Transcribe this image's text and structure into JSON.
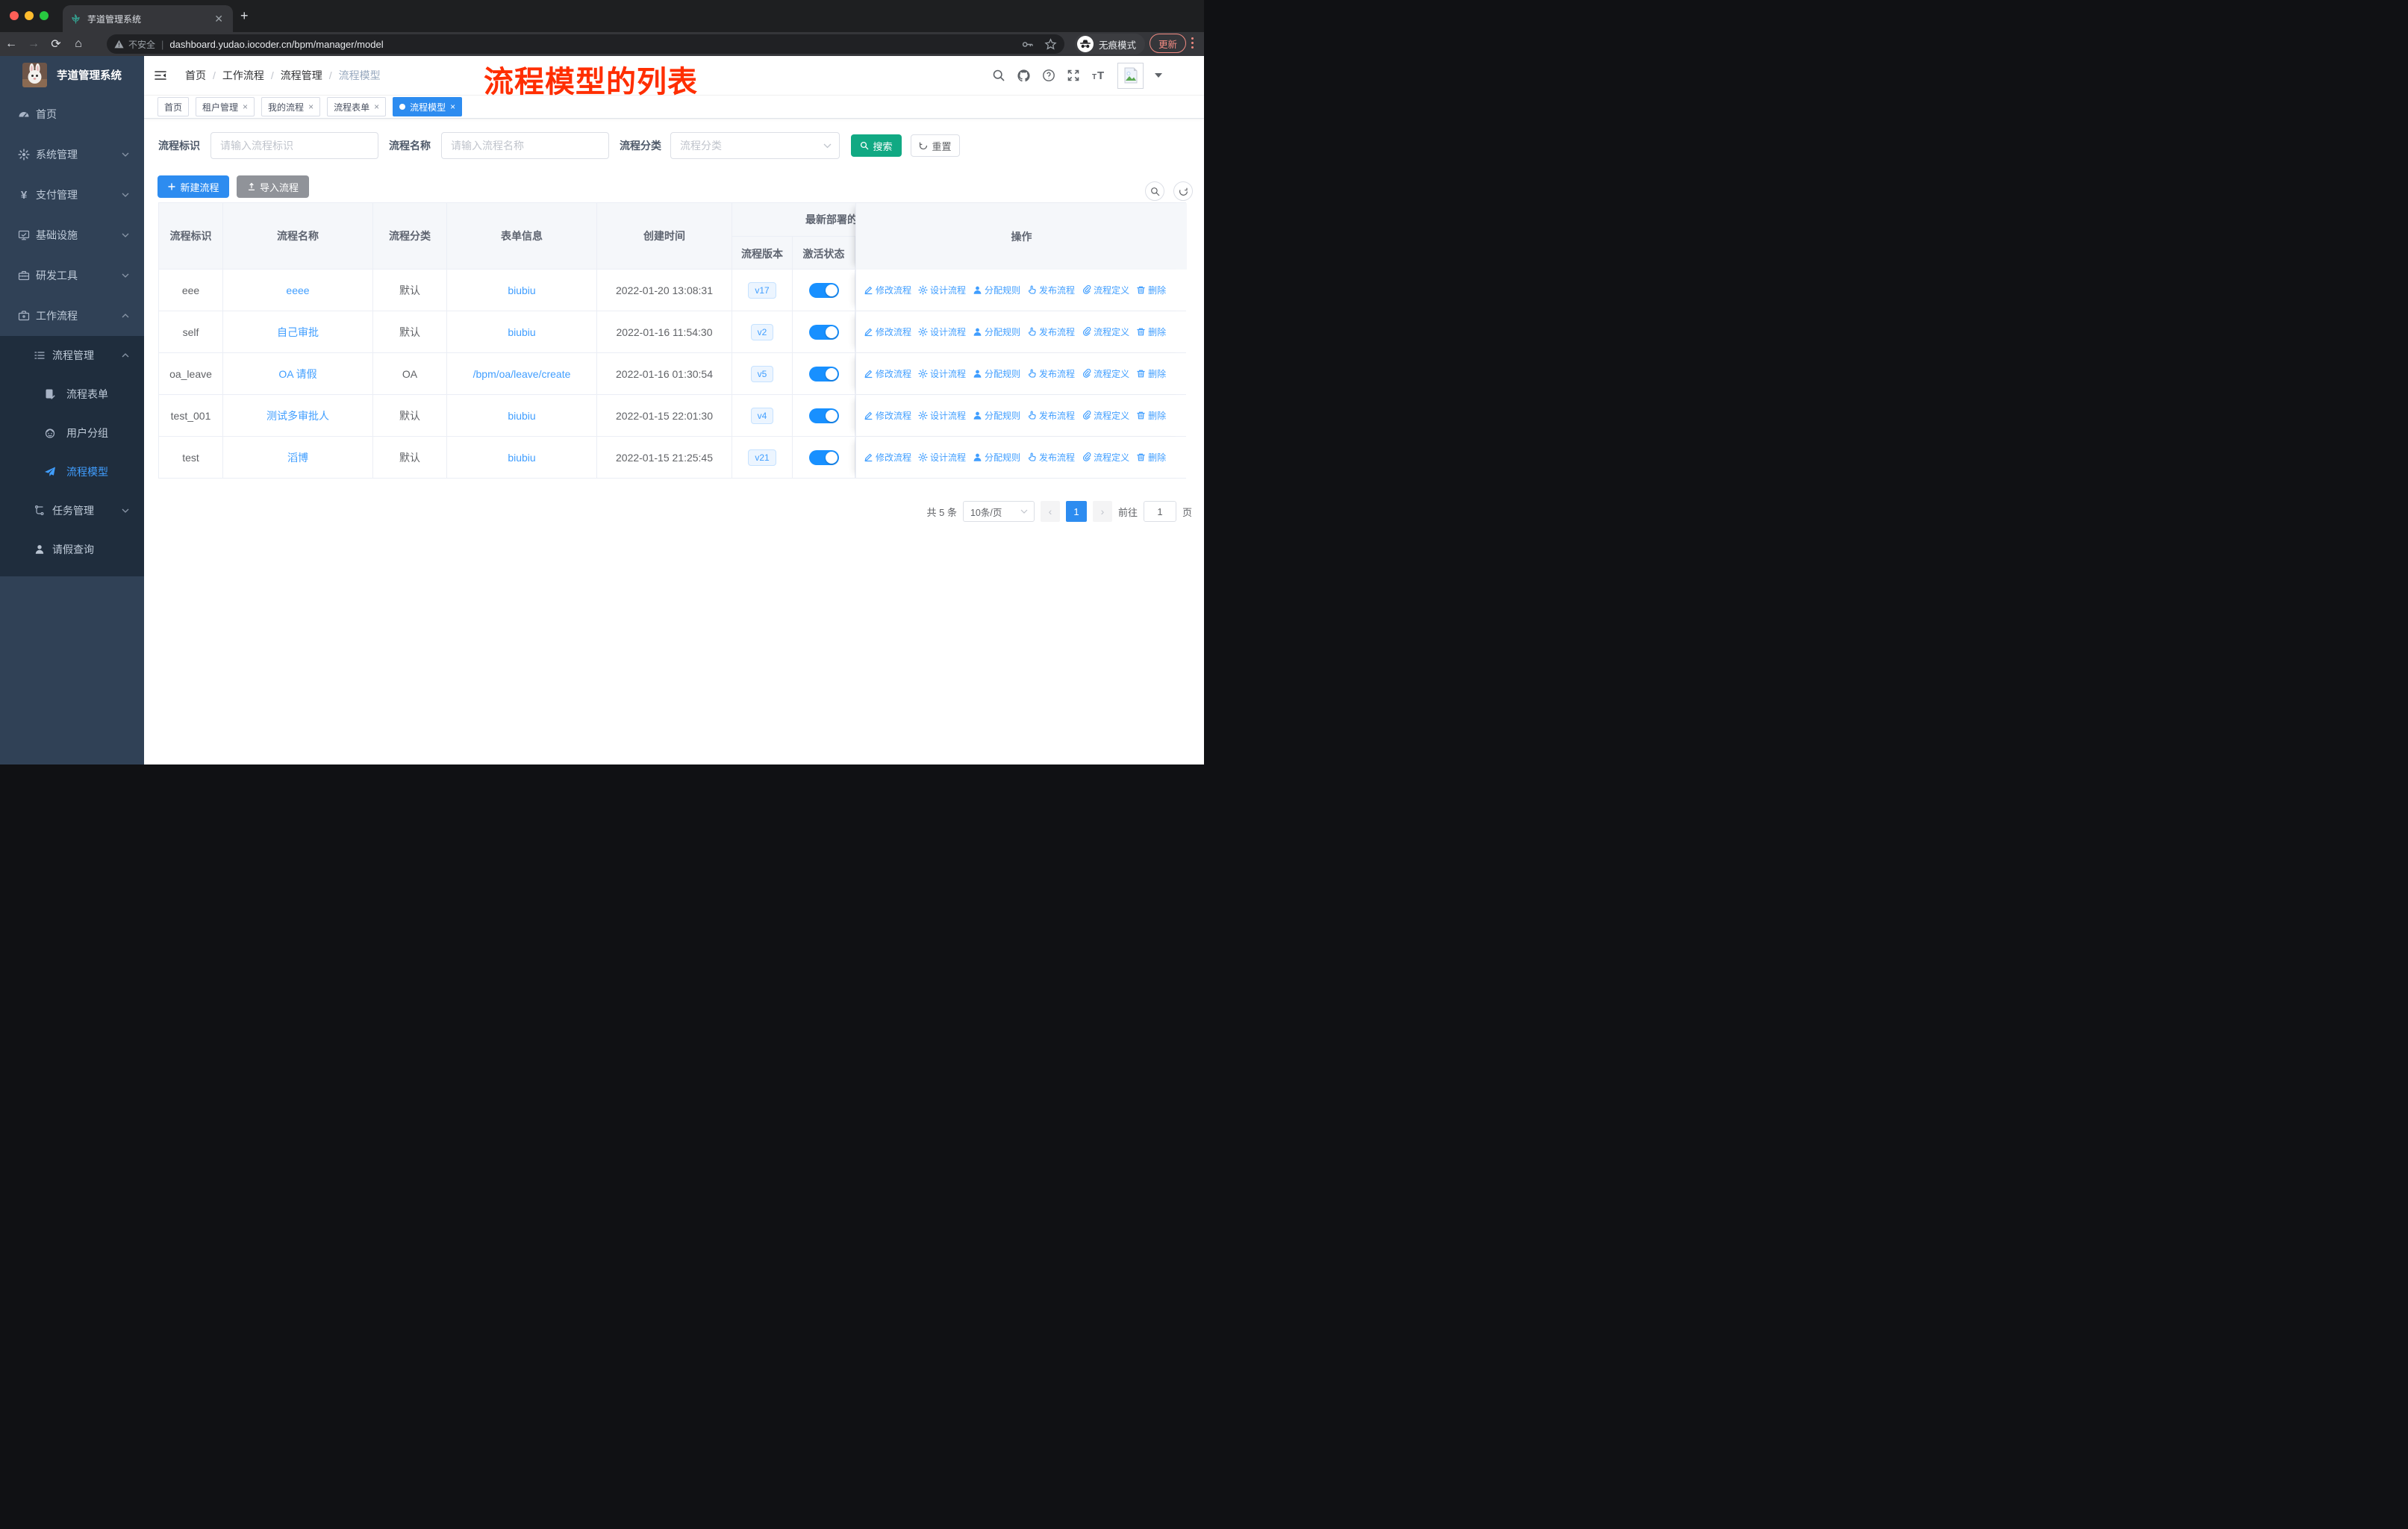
{
  "colors": {
    "primary_button": "#2d8cf0",
    "link_accent": "#409eff",
    "search_button": "#11a983",
    "toggle_on": "#1890ff",
    "annotation_red": "#ff2e00",
    "sidebar_bg": "#304156",
    "sidebar_submenu_bg": "#1f2d3d"
  },
  "browser": {
    "tab_title": "芋道管理系统",
    "security_label": "不安全",
    "url": "dashboard.yudao.iocoder.cn/bpm/manager/model",
    "incognito_label": "无痕模式",
    "update_label": "更新"
  },
  "sidebar": {
    "title": "芋道管理系统",
    "items": [
      {
        "label": "首页",
        "icon": "dashboard-icon"
      },
      {
        "label": "系统管理",
        "icon": "gear-icon"
      },
      {
        "label": "支付管理",
        "icon": "yen-icon"
      },
      {
        "label": "基础设施",
        "icon": "monitor-icon"
      },
      {
        "label": "研发工具",
        "icon": "toolbox-icon"
      },
      {
        "label": "工作流程",
        "icon": "briefcase-icon"
      }
    ],
    "submenu": [
      {
        "label": "流程管理",
        "icon": "list-icon"
      },
      {
        "label": "流程表单",
        "icon": "form-icon"
      },
      {
        "label": "用户分组",
        "icon": "group-icon"
      },
      {
        "label": "流程模型",
        "icon": "paper-plane-icon",
        "active": true
      },
      {
        "label": "任务管理",
        "icon": "tasks-icon"
      },
      {
        "label": "请假查询",
        "icon": "user-icon"
      }
    ]
  },
  "header": {
    "breadcrumb": [
      "首页",
      "工作流程",
      "流程管理",
      "流程模型"
    ],
    "annotation": "流程模型的列表"
  },
  "tags": [
    {
      "label": "首页"
    },
    {
      "label": "租户管理"
    },
    {
      "label": "我的流程"
    },
    {
      "label": "流程表单"
    },
    {
      "label": "流程模型"
    }
  ],
  "filters": {
    "key_label": "流程标识",
    "key_placeholder": "请输入流程标识",
    "name_label": "流程名称",
    "name_placeholder": "请输入流程名称",
    "category_label": "流程分类",
    "category_placeholder": "流程分类",
    "search_label": "搜索",
    "reset_label": "重置"
  },
  "toolbar": {
    "create_label": "新建流程",
    "import_label": "导入流程"
  },
  "table": {
    "headers": {
      "id": "流程标识",
      "name": "流程名称",
      "category": "流程分类",
      "form": "表单信息",
      "created": "创建时间",
      "deploy_group": "最新部署的",
      "version": "流程版本",
      "active": "激活状态",
      "actions": "操作"
    },
    "rows": [
      {
        "id": "eee",
        "name": "eeee",
        "category": "默认",
        "form": "biubiu",
        "created": "2022-01-20 13:08:31",
        "version": "v17",
        "active": true
      },
      {
        "id": "self",
        "name": "自己审批",
        "category": "默认",
        "form": "biubiu",
        "created": "2022-01-16 11:54:30",
        "version": "v2",
        "active": true
      },
      {
        "id": "oa_leave",
        "name": "OA 请假",
        "category": "OA",
        "form": "/bpm/oa/leave/create",
        "created": "2022-01-16 01:30:54",
        "version": "v5",
        "active": true
      },
      {
        "id": "test_001",
        "name": "测试多审批人",
        "category": "默认",
        "form": "biubiu",
        "created": "2022-01-15 22:01:30",
        "version": "v4",
        "active": true
      },
      {
        "id": "test",
        "name": "滔博",
        "category": "默认",
        "form": "biubiu",
        "created": "2022-01-15 21:25:45",
        "version": "v21",
        "active": true
      }
    ],
    "row_actions": [
      {
        "label": "修改流程",
        "icon": "edit"
      },
      {
        "label": "设计流程",
        "icon": "design"
      },
      {
        "label": "分配规则",
        "icon": "assign"
      },
      {
        "label": "发布流程",
        "icon": "deploy"
      },
      {
        "label": "流程定义",
        "icon": "definition"
      },
      {
        "label": "删除",
        "icon": "delete"
      }
    ]
  },
  "pagination": {
    "total": "共 5 条",
    "page_size": "10条/页",
    "prev": "‹",
    "page": "1",
    "next": "›",
    "goto_label": "前往",
    "goto_value": "1",
    "unit": "页"
  }
}
